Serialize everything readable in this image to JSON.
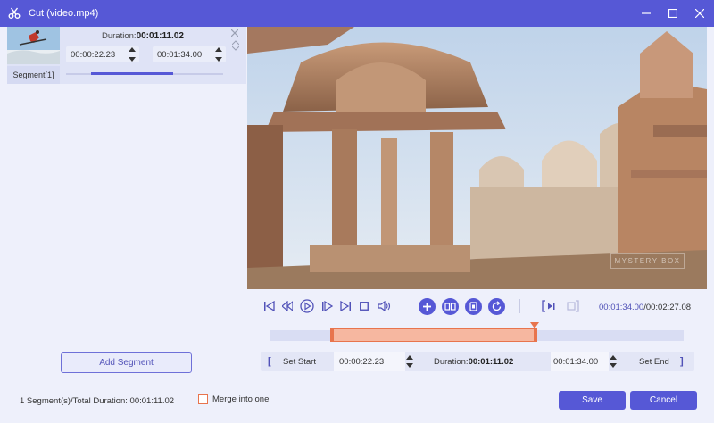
{
  "window": {
    "title": "Cut (video.mp4)"
  },
  "segment": {
    "label": "Segment[1]",
    "duration_label": "Duration:",
    "duration_value": "00:01:11.02",
    "start_time": "00:00:22.23",
    "end_time": "00:01:34.00",
    "progress_fraction": 0.52
  },
  "add_segment_label": "Add Segment",
  "video": {
    "watermark": "MYSTERY BOX"
  },
  "playback": {
    "current_time": "00:01:34.00",
    "separator": "/",
    "total_time": "00:02:27.08"
  },
  "edit_row": {
    "set_start_label": "Set Start",
    "start_time": "00:00:22.23",
    "duration_label": "Duration:",
    "duration_value": "00:01:11.02",
    "end_time": "00:01:34.00",
    "set_end_label": "Set End"
  },
  "footer": {
    "total_text": "1 Segment(s)/Total Duration: 00:01:11.02",
    "merge_label": "Merge into one",
    "merge_checked": false,
    "save_label": "Save",
    "cancel_label": "Cancel"
  },
  "colors": {
    "accent": "#5658d6",
    "selection": "#e8744d"
  }
}
